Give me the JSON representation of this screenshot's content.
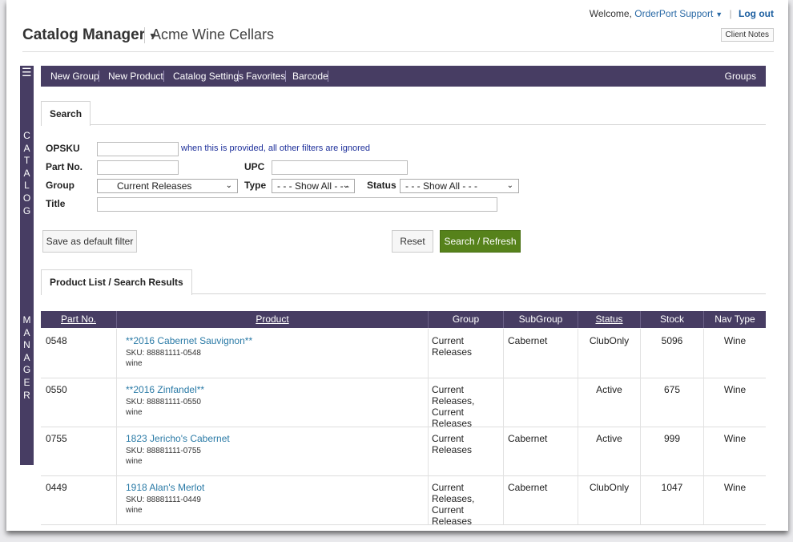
{
  "header": {
    "welcome_prefix": "Welcome,",
    "user_name": "OrderPort Support",
    "logout_label": "Log out",
    "client_notes_label": "Client Notes",
    "app_title": "Catalog Manager",
    "company": "Acme Wine Cellars"
  },
  "side_rail": {
    "word1": [
      "C",
      "A",
      "T",
      "A",
      "L",
      "O",
      "G"
    ],
    "word2": [
      "M",
      "A",
      "N",
      "A",
      "G",
      "E",
      "R"
    ]
  },
  "topnav": {
    "items": [
      "New Group",
      "New Product",
      "Catalog Settings",
      "Favorites",
      "Barcode"
    ],
    "right_item": "Groups"
  },
  "search_tab": {
    "label": "Search"
  },
  "filters": {
    "opsku_label": "OPSKU",
    "opsku_value": "",
    "opsku_hint": "when this is provided, all other filters are ignored",
    "partno_label": "Part No.",
    "partno_value": "",
    "upc_label": "UPC",
    "upc_value": "",
    "group_label": "Group",
    "group_selected": "Current Releases",
    "type_label": "Type",
    "type_selected": "- - - Show All - - -",
    "status_label": "Status",
    "status_selected": "- - - Show All - - -",
    "title_label": "Title",
    "title_value": ""
  },
  "buttons": {
    "save_default": "Save as default filter",
    "reset": "Reset",
    "search_refresh": "Search / Refresh"
  },
  "results_tab": {
    "label": "Product List / Search Results"
  },
  "table": {
    "columns": [
      "Part No.",
      "Product",
      "Group",
      "SubGroup",
      "Status",
      "Stock",
      "Nav Type"
    ],
    "rows": [
      {
        "part_no": "0548",
        "product": "**2016 Cabernet Sauvignon**",
        "sku": "SKU: 88881111-0548",
        "nav": "wine",
        "group": "Current Releases",
        "subgroup": "Cabernet",
        "status": "ClubOnly",
        "stock": "5096",
        "nav_type": "Wine"
      },
      {
        "part_no": "0550",
        "product": "**2016 Zinfandel**",
        "sku": "SKU: 88881111-0550",
        "nav": "wine",
        "group": "Current Releases, Current Releases",
        "subgroup": "",
        "status": "Active",
        "stock": "675",
        "nav_type": "Wine"
      },
      {
        "part_no": "0755",
        "product": "1823 Jericho's Cabernet",
        "sku": "SKU: 88881111-0755",
        "nav": "wine",
        "group": "Current Releases",
        "subgroup": "Cabernet",
        "status": "Active",
        "stock": "999",
        "nav_type": "Wine"
      },
      {
        "part_no": "0449",
        "product": "1918 Alan's Merlot",
        "sku": "SKU: 88881111-0449",
        "nav": "wine",
        "group": "Current Releases, Current Releases",
        "subgroup": "Cabernet",
        "status": "ClubOnly",
        "stock": "1047",
        "nav_type": "Wine"
      }
    ]
  },
  "colors": {
    "nav_purple": "#473d63",
    "link_blue": "#2a7aa6",
    "primary_green": "#56821b"
  }
}
